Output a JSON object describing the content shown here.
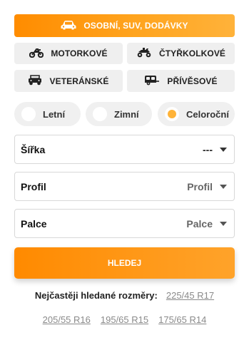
{
  "vehicle_types": [
    {
      "label": "OSOBNÍ, SUV, DODÁVKY",
      "icon": "car-icon",
      "active": true
    },
    {
      "label": "MOTORKOVÉ",
      "icon": "motorcycle-icon",
      "active": false
    },
    {
      "label": "ČTYŘKOLKOVÉ",
      "icon": "quad-icon",
      "active": false
    },
    {
      "label": "VETERÁNSKÉ",
      "icon": "vintage-car-icon",
      "active": false
    },
    {
      "label": "PŘÍVĚSOVÉ",
      "icon": "trailer-icon",
      "active": false
    }
  ],
  "seasons": [
    {
      "label": "Letní",
      "selected": false
    },
    {
      "label": "Zimní",
      "selected": false
    },
    {
      "label": "Celoroční",
      "selected": true
    }
  ],
  "selects": [
    {
      "label": "Šířka",
      "value": "---"
    },
    {
      "label": "Profil",
      "value": "Profil"
    },
    {
      "label": "Palce",
      "value": "Palce"
    }
  ],
  "search_button": "HLEDEJ",
  "popular": {
    "title": "Nejčastěji hledané rozměry:",
    "sizes": [
      "225/45 R17",
      "205/55 R16",
      "195/65 R15",
      "175/65 R14"
    ]
  },
  "colors": {
    "accent": "#ff8c00",
    "radio_selected": "#ffb338"
  }
}
